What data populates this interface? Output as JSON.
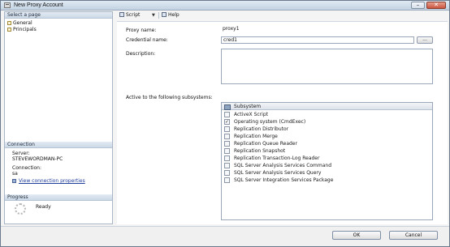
{
  "window": {
    "title": "New Proxy Account",
    "close_glyph": "✕",
    "minimize_glyph": "–"
  },
  "left_panel": {
    "select_page_header": "Select a page",
    "pages": [
      {
        "label": "General",
        "icon": "page-icon"
      },
      {
        "label": "Principals",
        "icon": "page-icon"
      }
    ],
    "connection_header": "Connection",
    "server_label": "Server:",
    "server_value": "STEVEWORDMAN-PC",
    "connection_label": "Connection:",
    "connection_value": "sa",
    "view_properties_link": "View connection properties",
    "progress_header": "Progress",
    "progress_status": "Ready"
  },
  "toolbar": {
    "script_label": "Script",
    "help_label": "Help",
    "dropdown_glyph": "▼"
  },
  "form": {
    "proxy_name_label": "Proxy name:",
    "proxy_name_value": "proxy1",
    "credential_name_label": "Credential name:",
    "credential_name_value": "cred1",
    "browse_label": "...",
    "description_label": "Description:",
    "description_value": "",
    "subsystems_label": "Active to the following subsystems:",
    "subsystem_column_header": "Subsystem",
    "subsystems": [
      {
        "label": "ActiveX Script",
        "checked": false
      },
      {
        "label": "Operating system (CmdExec)",
        "checked": true
      },
      {
        "label": "Replication Distributor",
        "checked": false
      },
      {
        "label": "Replication Merge",
        "checked": false
      },
      {
        "label": "Replication Queue Reader",
        "checked": false
      },
      {
        "label": "Replication Snapshot",
        "checked": false
      },
      {
        "label": "Replication Transaction-Log Reader",
        "checked": false
      },
      {
        "label": "SQL Server Analysis Services Command",
        "checked": false
      },
      {
        "label": "SQL Server Analysis Services Query",
        "checked": false
      },
      {
        "label": "SQL Server Integration Services Package",
        "checked": false
      }
    ]
  },
  "buttons": {
    "ok": "OK",
    "cancel": "Cancel"
  }
}
